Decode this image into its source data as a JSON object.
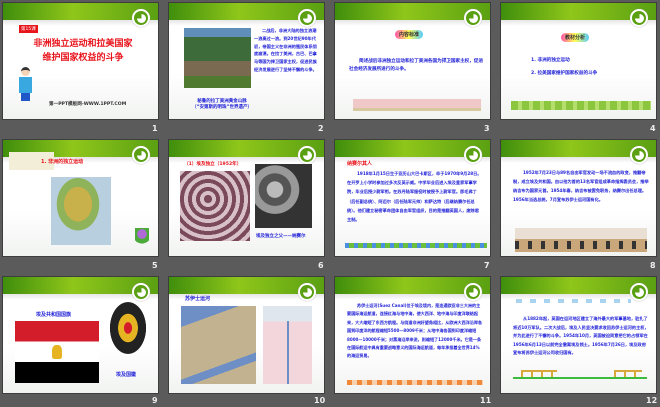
{
  "slides": [
    {
      "number": "1",
      "badge": "第15课",
      "title_line1": "非洲独立运动和拉美国家",
      "title_line2": "维护国家权益的斗争",
      "footer": "第一PPT模板网-WWW.1PPT.COM"
    },
    {
      "number": "2",
      "text": "二战后，非洲大陆的独立浪潮一浪高过一浪。到20世纪90年代初，帝国主义在非洲的殖民体系彻底崩溃。在拉丁美洲，古巴、巴拿马等国为捍卫国家主权，促进民族经济发展进行了坚持不懈的斗争。",
      "caption1": "秘鲁的拉丁美洲黄金山脉",
      "caption2": "（“安第斯的明珠”世界遗产）"
    },
    {
      "number": "3",
      "heading": "内容标准",
      "text": "简述战后非洲独立运动和拉丁美洲各国为捍卫国家主权，促进社会经济发展所进行的斗争。"
    },
    {
      "number": "4",
      "heading": "教材分析",
      "item1": "1. 非洲的独立运动",
      "item2": "2. 拉美国家维护国家权益的斗争"
    },
    {
      "number": "5",
      "heading": "1. 非洲的独立运动"
    },
    {
      "number": "6",
      "heading": "（1）埃及独立（1952年）",
      "caption": "埃及独立之父——纳赛尔"
    },
    {
      "number": "7",
      "heading": "纳赛尔其人",
      "text": "1918年1月15日生于亚历山大巴卡斯区，卒于1970年9月28日。在开罗上小学时参加过多次反英示威。中学毕业后进入埃及皇家军事学院，毕业后授少尉军衔。在苏丹陆军服役时被授予上尉军官。即毛弗丁（后任副总统）、阿迈尔（后任陆军元帅）和萨达特（后继纳赛尔任总统）。他们建立秘密革命团体自由军官组织，目的是推翻英国人，废除君主制。"
    },
    {
      "number": "8",
      "text": "1952年7月23日与89名自由军官发动一场不流血的政变，推翻帝制，成立埃及共和国。由以他为首的13名军官组成革命指挥委员会，推举纳吉布为国家元首。1954年春，纳吉布被罢免职务，纳赛尔出任总理。1956年当选总统，7月宣布苏伊士运河国有化。"
    },
    {
      "number": "9",
      "flag_caption": "埃及共和国国旗",
      "emblem_caption": "埃及国徽"
    },
    {
      "number": "10",
      "heading": "苏伊士运河"
    },
    {
      "number": "11",
      "text": "苏伊士运河(Suez Canal)位于埃及境内，是连通欧亚非三大洲的主要国际海运航道，连接红海与地中海，使大西洋、地中海与印度洋联结起来，大大缩短了东西方航程。与绕道非洲好望角相比，从欧洲大西洋沿岸各国到印度洋的航程缩短5500—8009千米；从地中海各国到印度洋缩短8000—10000千米；对黑海沿岸来说，则缩短了12000千米。它是一条在国际航运中具有重要战略意义的国际海运航道，每年承担着全世界14%的海运贸易。"
    },
    {
      "number": "12",
      "text": "从1882年起，英国在运河地区建立了海外最大的军事基地，驻扎了将近10万军队。二次大战后，埃及人民坚决要求收回苏伊士运河的主权，并为此进行了不懈的斗争。1954年10月，英国被迫同意把它的占领军在1956年6月13日以前完全撤离埃及领土。1956年7月26日，埃及政府宣布将苏伊士运河公司收归国有。"
    }
  ],
  "colors": {
    "background": "#5b5b5b",
    "band": "#5aa012",
    "title_red": "#e8141c",
    "text_blue": "#2424d8"
  }
}
